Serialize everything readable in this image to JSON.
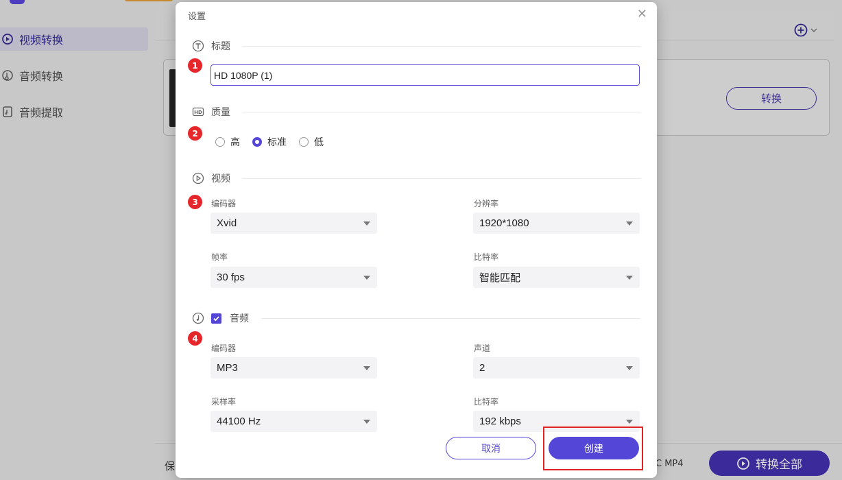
{
  "app": {
    "sidebar": [
      {
        "label": "视频转换",
        "icon": "video-convert-icon",
        "active": true
      },
      {
        "label": "音频转换",
        "icon": "audio-convert-icon",
        "active": false
      },
      {
        "label": "音频提取",
        "icon": "audio-extract-icon",
        "active": false
      }
    ],
    "card_convert_label": "转换",
    "save_label": "保",
    "format_label": "C MP4",
    "convert_all_label": "转换全部"
  },
  "dialog": {
    "title": "设置",
    "sections": {
      "title": {
        "label": "标题",
        "badge": "1",
        "value": "HD 1080P (1)"
      },
      "quality": {
        "label": "质量",
        "badge": "2",
        "options": [
          "高",
          "标准",
          "低"
        ],
        "selected": "标准"
      },
      "video": {
        "label": "视频",
        "badge": "3",
        "encoder": {
          "label": "编码器",
          "value": "Xvid"
        },
        "resolution": {
          "label": "分辨率",
          "value": "1920*1080"
        },
        "framerate": {
          "label": "帧率",
          "value": "30 fps"
        },
        "bitrate": {
          "label": "比特率",
          "value": "智能匹配"
        }
      },
      "audio": {
        "label": "音频",
        "badge": "4",
        "enabled": true,
        "encoder": {
          "label": "编码器",
          "value": "MP3"
        },
        "channel": {
          "label": "声道",
          "value": "2"
        },
        "samplerate": {
          "label": "采样率",
          "value": "44100 Hz"
        },
        "bitrate": {
          "label": "比特率",
          "value": "192 kbps"
        }
      }
    },
    "cancel_label": "取消",
    "create_label": "创建"
  },
  "colors": {
    "accent": "#5446d6",
    "badge": "#e5262b",
    "highlight": "#e02222"
  }
}
